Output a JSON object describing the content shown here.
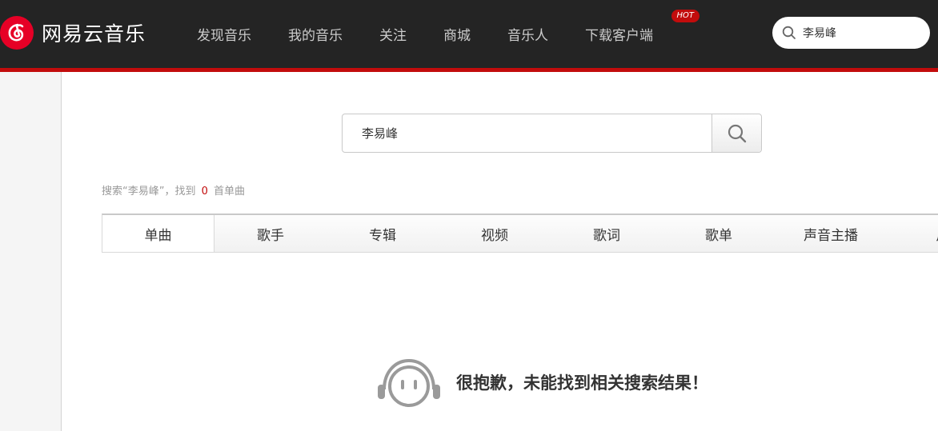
{
  "header": {
    "logo_text": "网易云音乐",
    "nav": [
      {
        "label": "发现音乐"
      },
      {
        "label": "我的音乐"
      },
      {
        "label": "关注"
      },
      {
        "label": "商城"
      },
      {
        "label": "音乐人"
      },
      {
        "label": "下载客户端",
        "badge": "HOT"
      }
    ],
    "search_value": "李易峰"
  },
  "search": {
    "query": "李易峰"
  },
  "summary": {
    "prefix": "搜索“李易峰”，找到",
    "count": "0",
    "suffix": "首单曲"
  },
  "tabs": [
    {
      "label": "单曲",
      "active": true
    },
    {
      "label": "歌手"
    },
    {
      "label": "专辑"
    },
    {
      "label": "视频"
    },
    {
      "label": "歌词"
    },
    {
      "label": "歌单"
    },
    {
      "label": "声音主播"
    },
    {
      "label": "用"
    }
  ],
  "empty_state": {
    "message": "很抱歉，未能找到相关搜索结果！"
  },
  "colors": {
    "brand_red": "#c20c0c",
    "header_bg": "#242424"
  }
}
